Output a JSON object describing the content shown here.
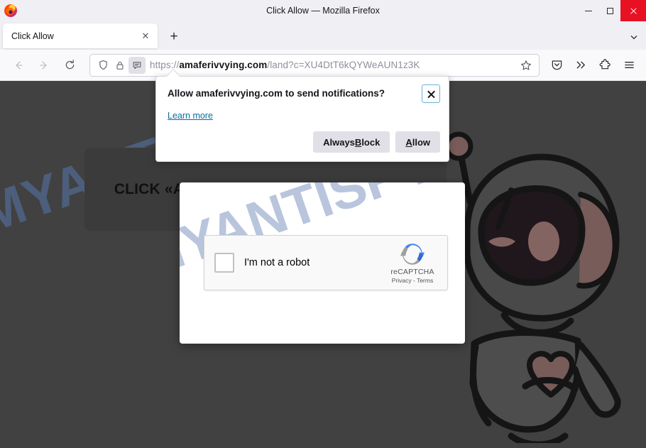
{
  "window": {
    "title": "Click Allow — Mozilla Firefox",
    "logo_icon": "firefox-logo",
    "minimize_icon": "minimize-icon",
    "maximize_icon": "maximize-icon",
    "close_icon": "close-icon",
    "close_color": "#e81123"
  },
  "tabs": {
    "items": [
      {
        "title": "Click Allow",
        "close_icon": "close-icon"
      }
    ],
    "new_tab_label": "+",
    "list_all_tabs_icon": "chevron-down-icon"
  },
  "nav": {
    "back_icon": "back-arrow-icon",
    "forward_icon": "forward-arrow-icon",
    "reload_icon": "reload-icon",
    "shield_icon": "shield-icon",
    "lock_icon": "lock-icon",
    "permission_icon": "notification-permission-icon",
    "bookmark_icon": "star-icon",
    "url_scheme": "https://",
    "url_host": "amaferivvying.com",
    "url_path": "/land?c=XU4DtT6kQYWeAUN1z3K",
    "url_full": "https://amaferivvying.com/land?c=XU4DtT6kQYWeAUN1z3K"
  },
  "toolbar": {
    "pocket_icon": "pocket-save-icon",
    "overflow_icon": "double-chevron-icon",
    "extensions_icon": "extensions-puzzle-icon",
    "menu_icon": "hamburger-menu-icon"
  },
  "doorhanger": {
    "title": "Allow amaferivvying.com to send notifications?",
    "close_icon": "close-icon",
    "learn_more": "Learn more",
    "always_block": {
      "pre": "Always ",
      "accel": "B",
      "post": "lock"
    },
    "allow": {
      "accel": "A",
      "post": "llow"
    },
    "focus_color": "#6ab0d8"
  },
  "page": {
    "heading": "CLICK «ALLOW» TO CONFIRM THAT YOU",
    "watermark": "MYANTISPYWARE.COM",
    "watermark_color": "#5676ad",
    "background_color": "#414141",
    "card_color": "#3b3b3b",
    "robot_icon": "robot-mascot-illustration"
  },
  "captcha": {
    "label": "I'm not a robot",
    "checkbox_icon": "checkbox-unchecked",
    "brand_icon": "recaptcha-logo",
    "brand_name": "reCAPTCHA",
    "terms": "Privacy - Terms"
  }
}
